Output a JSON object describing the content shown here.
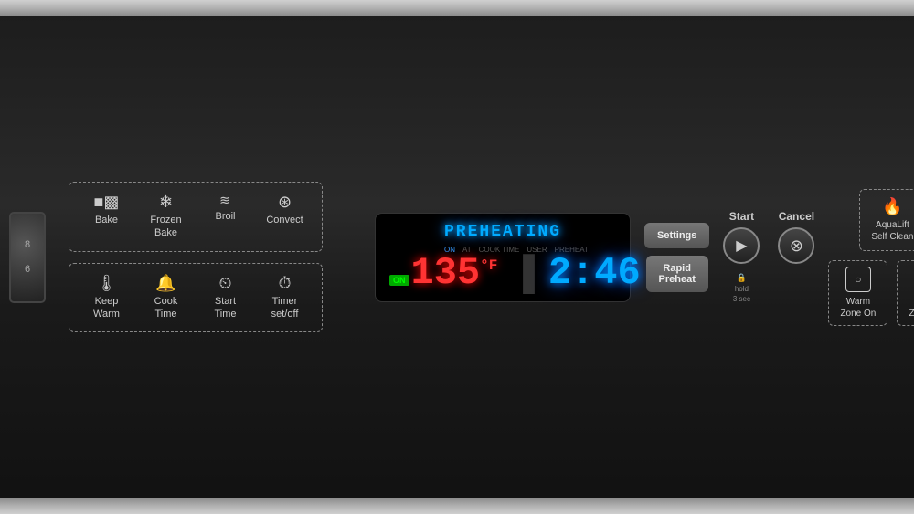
{
  "panel": {
    "status": "PREHEATING",
    "on_badge": "ON",
    "temperature": "135",
    "temp_unit": "°F",
    "time": "2:46",
    "display_labels": [
      "ON",
      "AT",
      "COOK TIME",
      "USER",
      "PREHEAT"
    ]
  },
  "buttons": {
    "row1": [
      {
        "id": "bake",
        "label": "Bake",
        "icon": "bake-icon"
      },
      {
        "id": "frozen-bake",
        "label": "Frozen\nBake",
        "icon": "frozen-icon"
      },
      {
        "id": "broil",
        "label": "Broil",
        "icon": "broil-icon"
      },
      {
        "id": "convect",
        "label": "Convect",
        "icon": "convect-icon"
      }
    ],
    "row2": [
      {
        "id": "keep-warm",
        "label": "Keep\nWarm",
        "icon": "keepwarm-icon"
      },
      {
        "id": "cook-time",
        "label": "Cook\nTime",
        "icon": "cooktime-icon"
      },
      {
        "id": "start-time",
        "label": "Start\nTime",
        "icon": "starttime-icon"
      },
      {
        "id": "timer-setoff",
        "label": "Timer\nset/off",
        "icon": "timer-icon"
      }
    ]
  },
  "center": {
    "settings_label": "Settings",
    "rapid_preheat_label": "Rapid\nPreheat",
    "start_label": "Start",
    "cancel_label": "Cancel",
    "hold_text": "hold\n3 sec"
  },
  "right": {
    "aqualift_label": "AquaLift\nSelf Clean",
    "warm_zone_on_label": "Warm\nZone On",
    "warm_zone_off_label": "Warm\nZone Off"
  }
}
